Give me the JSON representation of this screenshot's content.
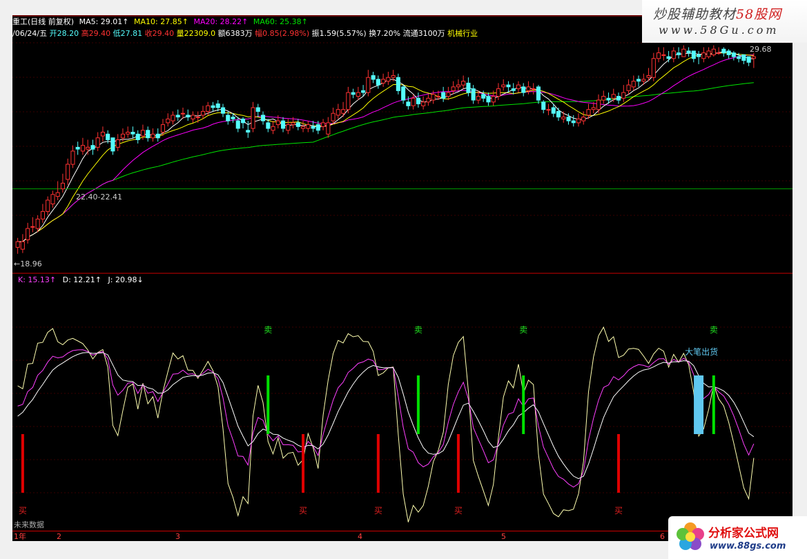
{
  "info_bar": {
    "name_prefix": "重工(日线 前复权)",
    "ma5": "MA5: 29.01↑",
    "ma10": "MA10: 27.85↑",
    "ma20": "MA20: 28.22↑",
    "ma60": "MA60: 25.38↑",
    "date": "/06/24/五",
    "open": "开28.20",
    "high": "高29.40",
    "low": "低27.81",
    "close": "收29.40",
    "volume": "量22309.0",
    "amount": "额6383万",
    "change": "幅0.85(2.98%)",
    "amplitude": "振1.59(5.57%)",
    "turnover": "换7.20%",
    "float": "流通3100万",
    "industry": "机械行业"
  },
  "labels": {
    "max_price": "29.68",
    "min_price": "←18.96",
    "mid_marker": "22.40-22.41",
    "future_data": "未来数据"
  },
  "kdj_bar": {
    "k": "K: 15.13↑",
    "d": "D: 12.21↑",
    "j": "J: 20.98↓"
  },
  "signals": {
    "buy": "买",
    "sell": "卖",
    "big_out": "大笔出货"
  },
  "time_axis": {
    "labels": [
      "1年",
      "2",
      "3",
      "4",
      "5",
      "6"
    ]
  },
  "logo_top": {
    "title_a": "炒股辅助教材",
    "title_b": "58股网",
    "url": "www.58Gu.com"
  },
  "logo_bottom": {
    "title": "分析家公式网",
    "url": "www.88gs.com"
  },
  "colors": {
    "up": "#ff3232",
    "down": "#54fcfc",
    "ma5": "#ffffff",
    "ma10": "#ffff00",
    "ma20": "#ff00ff",
    "ma60": "#00e600",
    "kline": "#ffffb0",
    "dline": "#ff40ff",
    "jline": "#ffffff",
    "buy_bar": "#e00000",
    "sell_bar": "#00e000",
    "out_bar": "#60c8f0"
  },
  "chart_data": [
    {
      "type": "candlestick",
      "title": "",
      "x": [
        1,
        2,
        3,
        4,
        5,
        6,
        7,
        8,
        9,
        10,
        11,
        12,
        13,
        14,
        15,
        16,
        17,
        18,
        19,
        20,
        21,
        22,
        23,
        24,
        25,
        26,
        27,
        28,
        29,
        30,
        31,
        32,
        33,
        34,
        35,
        36,
        37,
        38,
        39,
        40,
        41,
        42,
        43,
        44,
        45,
        46,
        47,
        48,
        49,
        50,
        51,
        52,
        53,
        54,
        55,
        56,
        57,
        58,
        59,
        60,
        61,
        62,
        63,
        64,
        65,
        66,
        67,
        68,
        69,
        70,
        71,
        72,
        73,
        74,
        75,
        76,
        77,
        78,
        79,
        80,
        81,
        82,
        83,
        84,
        85,
        86,
        87,
        88,
        89,
        90,
        91,
        92,
        93,
        94,
        95,
        96,
        97,
        98,
        99,
        100,
        101,
        102,
        103,
        104,
        105,
        106,
        107,
        108,
        109,
        110,
        111,
        112,
        113,
        114,
        115,
        116,
        117,
        118,
        119,
        120,
        121,
        122,
        123,
        124,
        125,
        126,
        127,
        128,
        129,
        130,
        131,
        132,
        133,
        134,
        135,
        136,
        137,
        138,
        139,
        140,
        141,
        142,
        143,
        144,
        145,
        146,
        147,
        148,
        149,
        150
      ],
      "open": [
        19.3,
        19.2,
        19.7,
        20.4,
        20.3,
        20.8,
        21.2,
        21.6,
        22.0,
        22.4,
        22.9,
        23.7,
        24.6,
        24.4,
        24.5,
        24.7,
        24.6,
        25.2,
        25.3,
        25.1,
        24.6,
        25.1,
        25.3,
        25.4,
        25.3,
        25.2,
        25.5,
        25.1,
        25.3,
        25.4,
        25.9,
        26.0,
        26.3,
        26.4,
        26.3,
        26.1,
        26.2,
        26.3,
        26.5,
        26.8,
        26.9,
        26.7,
        26.3,
        26.2,
        26.0,
        26.1,
        25.5,
        25.6,
        26.7,
        26.3,
        25.9,
        25.5,
        25.8,
        26.0,
        25.5,
        25.8,
        25.9,
        25.6,
        25.6,
        25.7,
        25.8,
        25.7,
        25.3,
        26.0,
        26.3,
        26.4,
        26.6,
        27.5,
        27.3,
        27.6,
        27.5,
        28.4,
        28.2,
        28.0,
        28.1,
        28.3,
        28.3,
        27.8,
        27.0,
        26.8,
        27.2,
        26.8,
        27.0,
        27.1,
        27.3,
        27.5,
        27.3,
        27.6,
        27.8,
        27.9,
        28.0,
        27.7,
        27.1,
        27.4,
        27.3,
        27.0,
        27.3,
        27.8,
        27.9,
        27.7,
        27.7,
        27.8,
        27.6,
        27.7,
        27.8,
        27.0,
        26.6,
        26.7,
        26.5,
        26.1,
        26.2,
        26.0,
        25.9,
        26.0,
        26.3,
        26.6,
        26.6,
        27.1,
        27.2,
        27.2,
        27.3,
        27.2,
        27.6,
        27.8,
        28.2,
        28.1,
        28.3,
        28.3,
        29.3,
        29.5,
        29.4,
        29.3,
        29.6,
        29.4,
        29.7,
        29.7,
        29.5,
        29.3,
        29.4,
        29.5,
        29.6,
        29.8,
        29.7,
        29.6,
        29.4,
        29.5,
        29.4,
        29.3,
        29.1,
        29.0
      ],
      "close": [
        19.6,
        19.6,
        20.3,
        20.4,
        20.8,
        21.2,
        21.8,
        22.1,
        22.2,
        22.7,
        23.7,
        24.4,
        24.5,
        24.7,
        24.6,
        24.5,
        25.1,
        25.4,
        25.0,
        24.4,
        25.0,
        25.3,
        25.4,
        25.3,
        25.0,
        25.5,
        25.1,
        25.3,
        25.1,
        25.8,
        26.1,
        26.3,
        26.2,
        26.4,
        26.2,
        26.3,
        26.2,
        26.5,
        26.8,
        26.7,
        26.7,
        26.4,
        26.0,
        26.1,
        25.6,
        25.9,
        25.4,
        26.7,
        26.5,
        26.0,
        25.6,
        25.7,
        26.0,
        25.6,
        25.8,
        25.9,
        25.7,
        25.7,
        25.8,
        25.6,
        25.5,
        25.9,
        25.9,
        26.4,
        26.6,
        26.6,
        27.5,
        27.4,
        27.5,
        27.5,
        28.3,
        28.2,
        27.9,
        28.2,
        28.3,
        28.4,
        27.6,
        27.1,
        26.8,
        27.2,
        26.9,
        27.0,
        27.2,
        27.4,
        27.3,
        27.2,
        27.5,
        27.8,
        27.9,
        28.1,
        27.5,
        27.1,
        27.3,
        27.2,
        27.0,
        27.3,
        27.7,
        27.9,
        27.8,
        27.6,
        27.9,
        27.5,
        27.8,
        27.7,
        27.1,
        26.6,
        26.6,
        26.4,
        26.2,
        26.2,
        26.0,
        25.9,
        26.1,
        26.2,
        26.6,
        26.7,
        27.1,
        27.3,
        27.1,
        27.4,
        27.1,
        27.5,
        27.9,
        28.1,
        28.1,
        28.2,
        28.4,
        29.3,
        29.6,
        29.5,
        29.3,
        29.7,
        29.5,
        29.8,
        29.6,
        29.3,
        29.4,
        29.6,
        29.7,
        29.8,
        29.6,
        29.6,
        29.5,
        29.4,
        29.3,
        29.2,
        29.1,
        29.4
      ],
      "high": [
        19.8,
        20.0,
        20.6,
        20.9,
        21.0,
        21.6,
        22.0,
        22.3,
        22.8,
        23.2,
        24.0,
        24.7,
        24.9,
        25.1,
        25.0,
        25.0,
        25.4,
        25.7,
        25.5,
        25.1,
        25.3,
        25.6,
        25.7,
        25.7,
        25.5,
        25.8,
        25.7,
        25.6,
        25.6,
        26.1,
        26.4,
        26.5,
        26.6,
        26.7,
        26.6,
        26.5,
        26.5,
        26.8,
        27.0,
        27.0,
        27.1,
        26.9,
        26.5,
        26.4,
        26.2,
        26.2,
        26.0,
        27.0,
        26.9,
        26.5,
        26.1,
        26.0,
        26.3,
        26.2,
        26.1,
        26.2,
        26.1,
        26.0,
        26.0,
        26.0,
        26.0,
        26.1,
        26.2,
        26.7,
        26.9,
        27.0,
        27.8,
        27.7,
        27.8,
        27.9,
        28.7,
        28.6,
        28.4,
        28.5,
        28.6,
        28.7,
        28.5,
        27.9,
        27.3,
        27.4,
        27.5,
        27.3,
        27.4,
        27.6,
        27.6,
        27.8,
        27.8,
        28.1,
        28.2,
        28.4,
        28.3,
        27.9,
        27.6,
        27.6,
        27.5,
        27.6,
        28.0,
        28.2,
        28.1,
        28.0,
        28.1,
        28.0,
        28.1,
        28.0,
        27.9,
        27.1,
        26.9,
        26.9,
        26.7,
        26.5,
        26.4,
        26.3,
        26.4,
        26.5,
        26.9,
        27.0,
        27.4,
        27.6,
        27.5,
        27.7,
        27.5,
        27.9,
        28.2,
        28.4,
        28.4,
        28.5,
        28.8,
        29.6,
        29.9,
        29.9,
        29.7,
        29.9,
        29.9,
        30.0,
        29.9,
        29.7,
        29.7,
        29.9,
        29.9,
        30.0,
        29.9,
        29.9,
        29.8,
        29.7,
        29.6,
        29.5,
        29.4,
        29.6
      ],
      "low": [
        18.96,
        19.0,
        19.5,
        20.1,
        20.1,
        20.6,
        21.0,
        21.4,
        21.8,
        22.2,
        22.6,
        23.5,
        24.2,
        24.2,
        24.2,
        24.2,
        24.4,
        24.9,
        24.8,
        24.2,
        24.4,
        24.9,
        25.1,
        25.1,
        24.8,
        25.0,
        24.9,
        24.9,
        24.9,
        25.2,
        25.7,
        25.8,
        26.0,
        26.1,
        26.0,
        25.9,
        25.9,
        26.1,
        26.3,
        26.5,
        26.5,
        26.2,
        25.8,
        25.9,
        25.4,
        25.6,
        25.1,
        25.4,
        26.2,
        25.8,
        25.4,
        25.3,
        25.6,
        25.4,
        25.3,
        25.6,
        25.5,
        25.4,
        25.4,
        25.4,
        25.3,
        25.5,
        25.1,
        25.8,
        26.1,
        26.2,
        26.4,
        27.2,
        27.1,
        27.3,
        27.3,
        28.0,
        27.7,
        27.8,
        27.9,
        28.1,
        27.4,
        26.9,
        26.6,
        26.6,
        26.7,
        26.6,
        26.8,
        26.9,
        27.1,
        27.0,
        27.1,
        27.4,
        27.6,
        27.7,
        27.3,
        26.9,
        26.9,
        27.0,
        26.8,
        26.8,
        27.1,
        27.6,
        27.5,
        27.4,
        27.5,
        27.3,
        27.4,
        27.4,
        26.9,
        26.4,
        26.3,
        26.2,
        26.0,
        25.9,
        25.8,
        25.7,
        25.7,
        25.8,
        26.1,
        26.4,
        26.4,
        26.9,
        26.9,
        27.0,
        26.9,
        27.0,
        27.4,
        27.6,
        27.8,
        27.9,
        28.1,
        28.1,
        29.1,
        29.2,
        29.1,
        29.1,
        29.3,
        29.4,
        29.4,
        29.1,
        29.0,
        29.1,
        29.3,
        29.4,
        29.5,
        29.4,
        29.3,
        29.2,
        29.1,
        29.0,
        28.9,
        28.8
      ],
      "ylim": [
        18.0,
        30.5
      ],
      "series": [
        {
          "name": "MA5",
          "values": []
        },
        {
          "name": "MA10",
          "values": []
        },
        {
          "name": "MA20",
          "values": []
        },
        {
          "name": "MA60",
          "values": []
        }
      ],
      "annotations": [
        "29.68",
        "←18.96",
        "22.40-22.41"
      ]
    },
    {
      "type": "line",
      "title": "",
      "series": [
        {
          "name": "K",
          "values": []
        },
        {
          "name": "D",
          "values": []
        },
        {
          "name": "J",
          "values": []
        }
      ],
      "ylim": [
        0,
        100
      ],
      "signal_bars": [
        {
          "type": "buy",
          "x": 2,
          "label": "买"
        },
        {
          "type": "sell",
          "x": 51,
          "label": "卖"
        },
        {
          "type": "buy",
          "x": 58,
          "label": "买"
        },
        {
          "type": "buy",
          "x": 73,
          "label": "买"
        },
        {
          "type": "sell",
          "x": 81,
          "label": "卖"
        },
        {
          "type": "buy",
          "x": 89,
          "label": "买"
        },
        {
          "type": "sell",
          "x": 102,
          "label": "卖"
        },
        {
          "type": "buy",
          "x": 121,
          "label": "买"
        },
        {
          "type": "out",
          "x": 137,
          "label": "大笔出货"
        },
        {
          "type": "sell",
          "x": 140,
          "label": "卖"
        }
      ]
    }
  ]
}
